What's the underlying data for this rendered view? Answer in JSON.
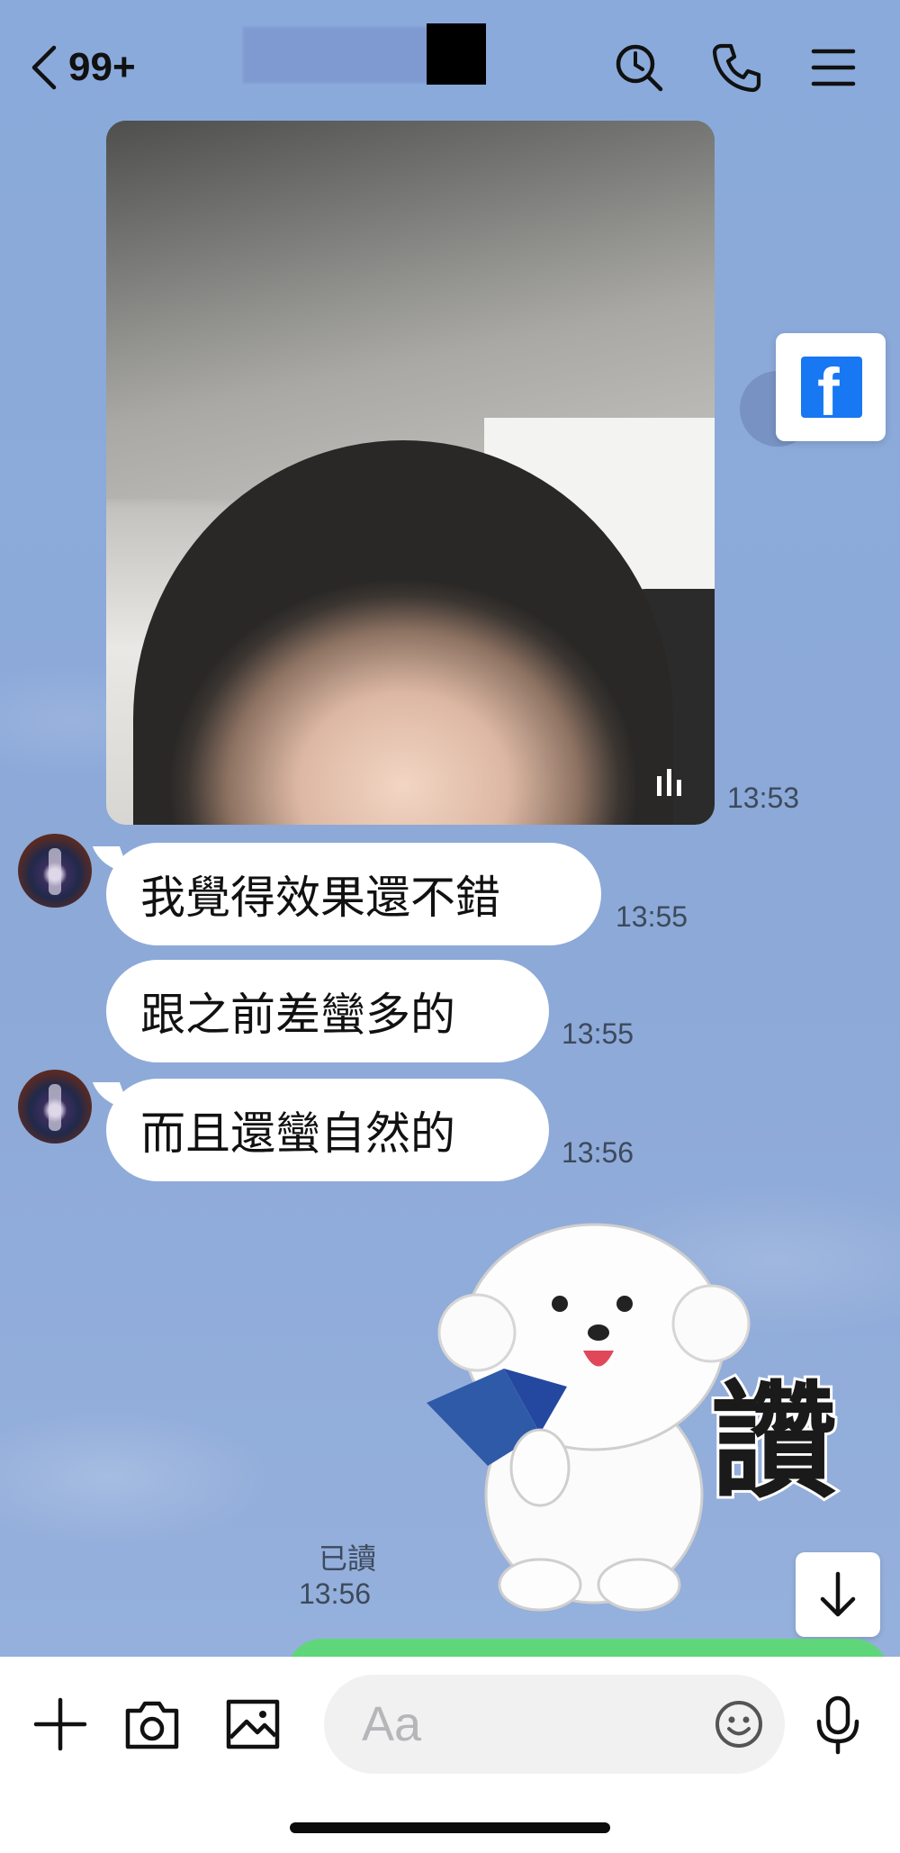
{
  "header": {
    "unread_count": "99+"
  },
  "messages": [
    {
      "type": "image",
      "time": "13:53"
    },
    {
      "type": "text",
      "text": "我覺得效果還不錯",
      "time": "13:55"
    },
    {
      "type": "text",
      "text": "跟之前差蠻多的",
      "time": "13:55"
    },
    {
      "type": "text",
      "text": "而且還蠻自然的",
      "time": "13:56"
    },
    {
      "type": "sticker",
      "sticker_text": "讚",
      "read": "已讀",
      "time": "13:56"
    }
  ],
  "input": {
    "placeholder": "Aa"
  },
  "colors": {
    "chat_background": "#8aa7d9",
    "bubble": "#ffffff",
    "facebook": "#1877f2",
    "sent_bubble": "#5fd67a"
  }
}
